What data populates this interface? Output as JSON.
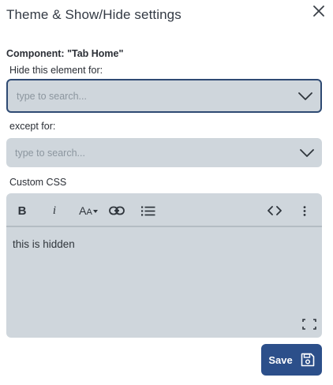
{
  "dialog": {
    "title": "Theme & Show/Hide settings",
    "close_icon": "close-icon"
  },
  "component": {
    "label": "Component: \"Tab Home\""
  },
  "hide_for": {
    "label": "Hide this element for:",
    "placeholder": "type to search...",
    "icon": "chevron-down-icon"
  },
  "except_for": {
    "label": "except for:",
    "placeholder": "type to search...",
    "icon": "chevron-down-icon"
  },
  "custom_css": {
    "label": "Custom CSS",
    "toolbar": {
      "bold": "B",
      "italic": "i",
      "font_size_big": "A",
      "font_size_small": "A",
      "icons": [
        "bold-icon",
        "italic-icon",
        "font-size-icon",
        "link-icon",
        "bullet-list-icon",
        "code-view-icon",
        "more-options-icon"
      ]
    },
    "content": "this is hidden",
    "fullscreen_icon": "fullscreen-icon"
  },
  "save_button": {
    "label": "Save",
    "icon": "floppy-disk-icon"
  },
  "colors": {
    "primary": "#2c4f8a",
    "input_bg": "#cfd6dc",
    "focus_border": "#2e4a73"
  }
}
